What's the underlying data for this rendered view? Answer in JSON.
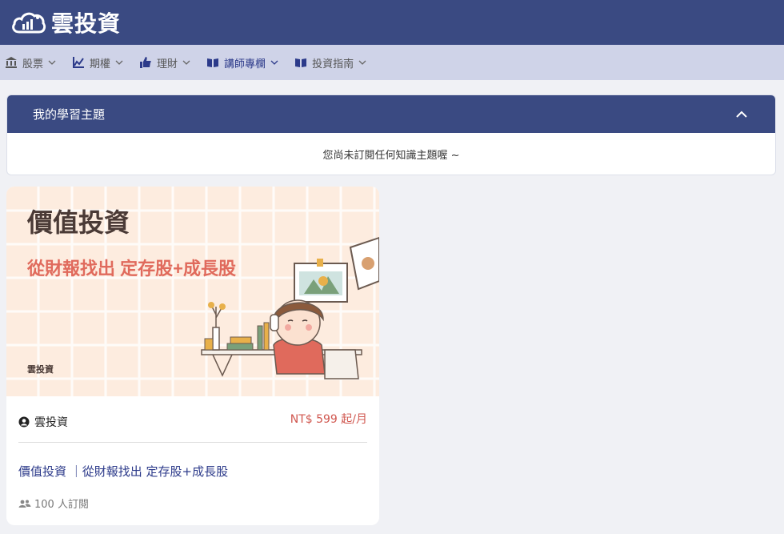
{
  "header": {
    "brand": "雲投資"
  },
  "nav": [
    {
      "label": "股票",
      "icon": "bank-icon"
    },
    {
      "label": "期權",
      "icon": "chart-line-icon"
    },
    {
      "label": "理財",
      "icon": "thumbs-up-icon"
    },
    {
      "label": "講師專欄",
      "icon": "book-open-icon"
    },
    {
      "label": "投資指南",
      "icon": "book-open-icon"
    }
  ],
  "topics": {
    "title": "我的學習主題",
    "empty_message": "您尚未訂閱任何知識主題喔 ~"
  },
  "course": {
    "banner_title": "價值投資",
    "banner_subtitle": "從財報找出 定存股+成長股",
    "banner_brand": "雲投資",
    "author": "雲投資",
    "price": "NT$ 599 起/月",
    "title": "價值投資 ｜從財報找出 定存股+成長股",
    "subscribers": "100 人訂閱"
  },
  "colors": {
    "primary": "#3a4a82",
    "nav_bg": "#cfd3e8",
    "price": "#d0574f",
    "banner_bg": "#fdecdf",
    "banner_subtitle": "#e06a5c"
  }
}
